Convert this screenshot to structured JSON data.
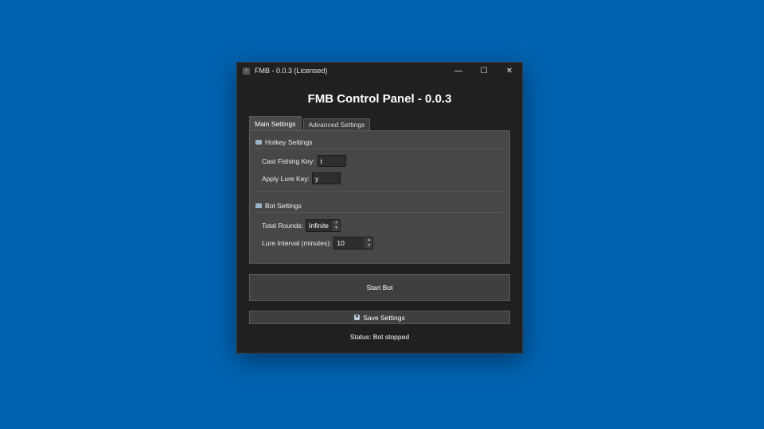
{
  "window": {
    "title": "FMB - 0.0.3 (Licensed)",
    "minimize_symbol": "—",
    "maximize_symbol": "☐",
    "close_symbol": "✕"
  },
  "heading": "FMB Control Panel - 0.0.3",
  "tabs": [
    {
      "label": "Main Settings",
      "active": true
    },
    {
      "label": "Advanced Settings",
      "active": false
    }
  ],
  "hotkey_settings": {
    "title": "Hotkey Settings",
    "icon": "keyboard-icon",
    "cast_label": "Cast Fishing Key:",
    "cast_value": "t",
    "lure_label": "Apply Lure Key:",
    "lure_value": "y"
  },
  "bot_settings": {
    "title": "Bot Settings",
    "icon": "bus-icon",
    "rounds_label": "Total Rounds:",
    "rounds_value": "Infinite",
    "interval_label": "Lure Interval (minutes):",
    "interval_value": "10"
  },
  "buttons": {
    "start": "Start Bot",
    "save": "Save Settings",
    "save_icon": "floppy-disk-icon"
  },
  "status": "Status: Bot stopped",
  "colors": {
    "desktop": "#0063b1",
    "window_bg": "#202020",
    "panel_bg": "#474747"
  }
}
